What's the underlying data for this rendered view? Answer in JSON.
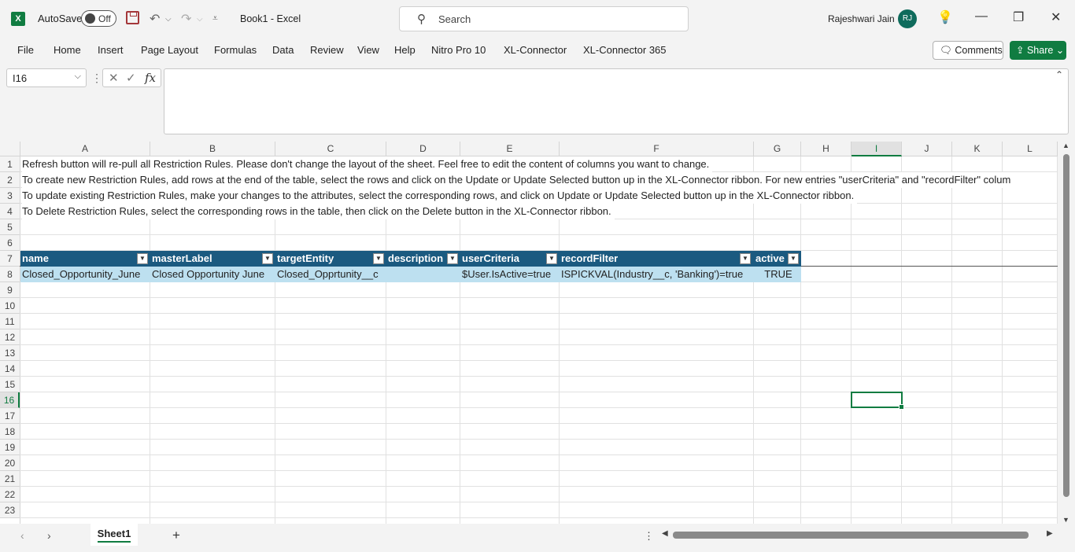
{
  "titlebar": {
    "app_icon": "X",
    "autosave_label": "AutoSave",
    "autosave_state": "Off",
    "document_title": "Book1  -  Excel",
    "search_placeholder": "Search",
    "user_name": "Rajeshwari Jain",
    "user_initials": "RJ"
  },
  "menu": {
    "items": [
      "File",
      "Home",
      "Insert",
      "Page Layout",
      "Formulas",
      "Data",
      "Review",
      "View",
      "Help",
      "Nitro Pro 10",
      "XL-Connector",
      "XL-Connector 365"
    ],
    "comments_label": "Comments",
    "share_label": "Share"
  },
  "formula_bar": {
    "name_box": "I16",
    "formula": ""
  },
  "grid": {
    "columns": [
      "A",
      "B",
      "C",
      "D",
      "E",
      "F",
      "G",
      "H",
      "I",
      "J",
      "K",
      "L"
    ],
    "selected_column": "I",
    "rows": [
      "1",
      "2",
      "3",
      "4",
      "5",
      "6",
      "7",
      "8",
      "9",
      "10",
      "11",
      "12",
      "13",
      "14",
      "15",
      "16",
      "17",
      "18",
      "19",
      "20",
      "21",
      "22",
      "23"
    ],
    "selected_row": "16",
    "notes": [
      "Refresh button will re-pull all Restriction Rules. Please don't change the layout of the sheet. Feel free to edit the content of columns you want to change.",
      "To create new Restriction Rules, add rows at the end of the table, select the rows and click on the Update or Update Selected button up in the XL-Connector ribbon. For new entries \"userCriteria\" and \"recordFilter\" colum",
      "To update existing Restriction Rules, make your changes to the attributes, select the corresponding rows, and click on Update or Update Selected button up in the XL-Connector ribbon.",
      "To Delete Restriction Rules, select the corresponding rows in the table, then click on the Delete button in the XL-Connector ribbon."
    ],
    "table_headers": [
      "name",
      "masterLabel",
      "targetEntity",
      "description",
      "userCriteria",
      "recordFilter",
      "active"
    ],
    "table_row": [
      "Closed_Opportunity_June",
      "Closed Opportunity June",
      "Closed_Opprtunity__c",
      "",
      "$User.IsActive=true",
      "ISPICKVAL(Industry__c, 'Banking')=true",
      "TRUE"
    ]
  },
  "sheet_tabs": {
    "active": "Sheet1"
  },
  "colors": {
    "accent": "#107c41",
    "table_header": "#1b5a80",
    "table_row": "#bde0f0"
  }
}
